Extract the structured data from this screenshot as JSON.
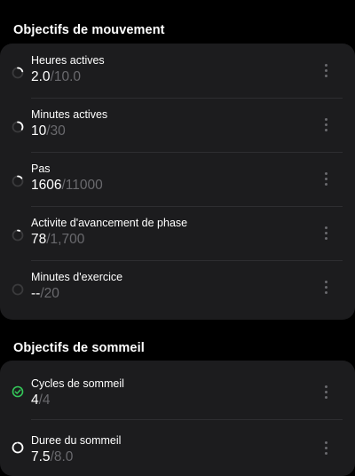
{
  "movement": {
    "title": "Objectifs de mouvement",
    "items": [
      {
        "label": "Heures actives",
        "current": "2.0",
        "target": "/10.0",
        "progress": 0.2,
        "icon": "progress-ring-icon"
      },
      {
        "label": "Minutes actives",
        "current": "10",
        "target": "/30",
        "progress": 0.333,
        "icon": "progress-ring-icon"
      },
      {
        "label": "Pas",
        "current": "1606",
        "target": "/11000",
        "progress": 0.146,
        "icon": "progress-ring-icon"
      },
      {
        "label": "Activite d'avancement de phase",
        "current": "78",
        "target": "/1,700",
        "progress": 0.046,
        "icon": "progress-ring-icon"
      },
      {
        "label": "Minutes d'exercice",
        "current": "--",
        "target": "/20",
        "progress": 0,
        "icon": "progress-ring-icon"
      }
    ]
  },
  "sleep": {
    "title": "Objectifs de sommeil",
    "items": [
      {
        "label": "Cycles de sommeil",
        "current": "4",
        "target": "/4",
        "progress": 1,
        "icon": "check-circle-icon"
      },
      {
        "label": "Duree du sommeil",
        "current": "7.5",
        "target": "/8.0",
        "progress": 0.9375,
        "icon": "progress-ring-icon"
      }
    ]
  },
  "colors": {
    "background": "#000000",
    "card": "#1c1c1e",
    "track": "#3a3a3c",
    "progress": "#ffffff",
    "complete": "#34c759",
    "muted": "#6a6a6e"
  }
}
